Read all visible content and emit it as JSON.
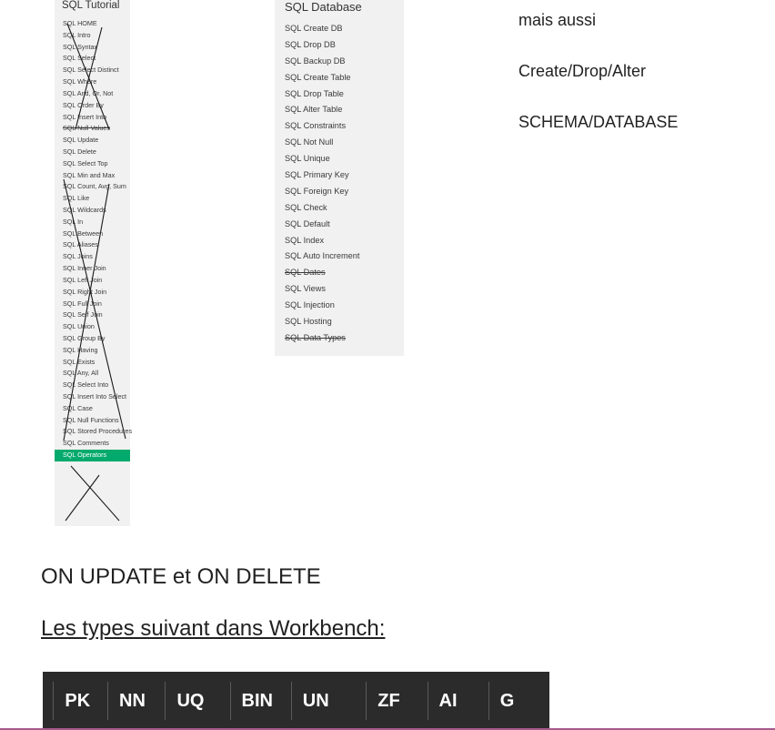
{
  "tutorial": {
    "title": "SQL Tutorial",
    "items": [
      {
        "label": "SQL HOME"
      },
      {
        "label": "SQL Intro"
      },
      {
        "label": "SQL Syntax"
      },
      {
        "label": "SQL Select"
      },
      {
        "label": "SQL Select Distinct"
      },
      {
        "label": "SQL Where"
      },
      {
        "label": "SQL And, Or, Not"
      },
      {
        "label": "SQL Order By"
      },
      {
        "label": "SQL Insert Into"
      },
      {
        "label": "SQL Null Values",
        "struck": true
      },
      {
        "label": "SQL Update"
      },
      {
        "label": "SQL Delete"
      },
      {
        "label": "SQL Select Top"
      },
      {
        "label": "SQL Min and Max"
      },
      {
        "label": "SQL Count, Avg, Sum"
      },
      {
        "label": "SQL Like"
      },
      {
        "label": "SQL Wildcards"
      },
      {
        "label": "SQL In"
      },
      {
        "label": "SQL Between"
      },
      {
        "label": "SQL Aliases"
      },
      {
        "label": "SQL Joins"
      },
      {
        "label": "SQL Inner Join"
      },
      {
        "label": "SQL Left Join"
      },
      {
        "label": "SQL Right Join"
      },
      {
        "label": "SQL Full Join"
      },
      {
        "label": "SQL Self Join"
      },
      {
        "label": "SQL Union"
      },
      {
        "label": "SQL Group By"
      },
      {
        "label": "SQL Having"
      },
      {
        "label": "SQL Exists"
      },
      {
        "label": "SQL Any, All"
      },
      {
        "label": "SQL Select Into"
      },
      {
        "label": "SQL Insert Into Select"
      },
      {
        "label": "SQL Case"
      },
      {
        "label": "SQL Null Functions"
      },
      {
        "label": "SQL Stored Procedures"
      },
      {
        "label": "SQL Comments"
      },
      {
        "label": "SQL Operators",
        "active": true
      }
    ]
  },
  "database": {
    "title": "SQL Database",
    "items": [
      {
        "label": "SQL Create DB"
      },
      {
        "label": "SQL Drop DB"
      },
      {
        "label": "SQL Backup DB"
      },
      {
        "label": "SQL Create Table"
      },
      {
        "label": "SQL Drop Table"
      },
      {
        "label": "SQL Alter Table"
      },
      {
        "label": "SQL Constraints"
      },
      {
        "label": "SQL Not Null"
      },
      {
        "label": "SQL Unique"
      },
      {
        "label": "SQL Primary Key"
      },
      {
        "label": "SQL Foreign Key"
      },
      {
        "label": "SQL Check"
      },
      {
        "label": "SQL Default"
      },
      {
        "label": "SQL Index"
      },
      {
        "label": "SQL Auto Increment"
      },
      {
        "label": "SQL Dates",
        "struck": true
      },
      {
        "label": "SQL Views"
      },
      {
        "label": "SQL Injection"
      },
      {
        "label": "SQL Hosting"
      },
      {
        "label": "SQL Data Types",
        "struck": true
      }
    ]
  },
  "notes": {
    "line1": "mais aussi",
    "line2": "Create/Drop/Alter",
    "line3": "SCHEMA/DATABASE"
  },
  "on_update_text": "ON UPDATE et  ON DELETE",
  "types_heading": "Les types suivant dans Workbench:",
  "toolbar": {
    "items": [
      "PK",
      "NN",
      "UQ",
      "BIN",
      "UN",
      "ZF",
      "AI",
      "G"
    ]
  },
  "colors": {
    "active_item": "#04aa6d",
    "toolbar_bg": "#2b2b2b",
    "panel_bg": "#f1f1f1"
  }
}
